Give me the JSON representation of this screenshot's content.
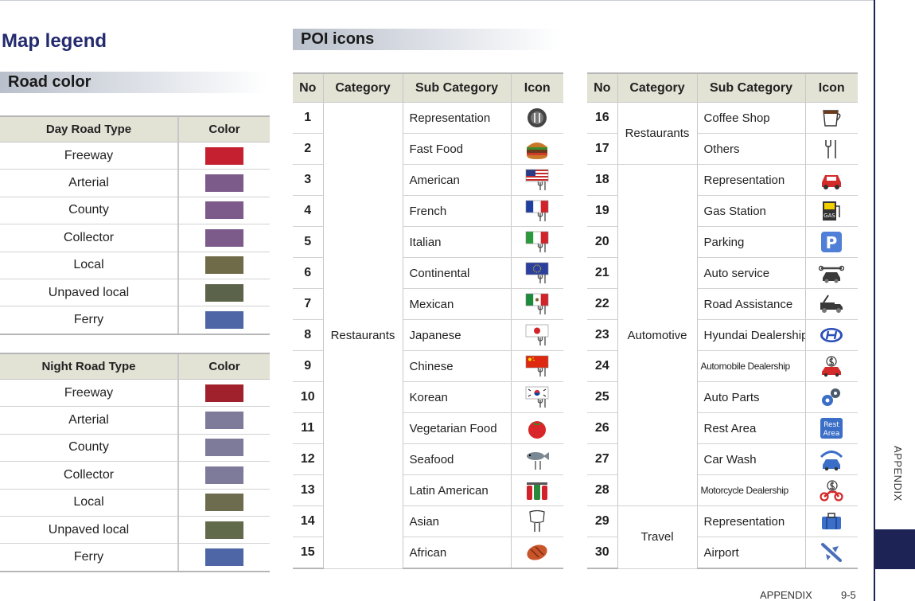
{
  "page_title": "Map legend",
  "sections": {
    "road": "Road color",
    "poi": "POI icons"
  },
  "day_table": {
    "headers": [
      "Day Road Type",
      "Color"
    ],
    "rows": [
      {
        "type": "Freeway",
        "color": "#c5202f"
      },
      {
        "type": "Arterial",
        "color": "#7c5b8a"
      },
      {
        "type": "County",
        "color": "#7c5b8a"
      },
      {
        "type": "Collector",
        "color": "#7c5b8a"
      },
      {
        "type": "Local",
        "color": "#6f6a48"
      },
      {
        "type": "Unpaved local",
        "color": "#5b644a"
      },
      {
        "type": "Ferry",
        "color": "#4f66a6"
      }
    ]
  },
  "night_table": {
    "headers": [
      "Night Road Type",
      "Color"
    ],
    "rows": [
      {
        "type": "Freeway",
        "color": "#a0212c"
      },
      {
        "type": "Arterial",
        "color": "#7d7b99"
      },
      {
        "type": "County",
        "color": "#7d7b99"
      },
      {
        "type": "Collector",
        "color": "#7d7b99"
      },
      {
        "type": "Local",
        "color": "#6e6c4e"
      },
      {
        "type": "Unpaved local",
        "color": "#616b4c"
      },
      {
        "type": "Ferry",
        "color": "#4f66a6"
      }
    ]
  },
  "poi_headers": [
    "No",
    "Category",
    "Sub Category",
    "Icon"
  ],
  "poi_left": {
    "categories": [
      {
        "label": "Restaurants",
        "span": 15
      }
    ],
    "rows": [
      {
        "no": "1",
        "sub": "Representation",
        "icon": "restaurant-plate-icon"
      },
      {
        "no": "2",
        "sub": "Fast Food",
        "icon": "burger-icon"
      },
      {
        "no": "3",
        "sub": "American",
        "icon": "us-flag-fork-icon"
      },
      {
        "no": "4",
        "sub": "French",
        "icon": "french-flag-fork-icon"
      },
      {
        "no": "5",
        "sub": "Italian",
        "icon": "italian-flag-fork-icon"
      },
      {
        "no": "6",
        "sub": "Continental",
        "icon": "eu-flag-fork-icon"
      },
      {
        "no": "7",
        "sub": "Mexican",
        "icon": "mexican-flag-fork-icon"
      },
      {
        "no": "8",
        "sub": "Japanese",
        "icon": "japanese-flag-fork-icon"
      },
      {
        "no": "9",
        "sub": "Chinese",
        "icon": "chinese-flag-fork-icon"
      },
      {
        "no": "10",
        "sub": "Korean",
        "icon": "korean-flag-fork-icon"
      },
      {
        "no": "11",
        "sub": "Vegetarian Food",
        "icon": "tomato-icon"
      },
      {
        "no": "12",
        "sub": "Seafood",
        "icon": "fish-icon"
      },
      {
        "no": "13",
        "sub": "Latin American",
        "icon": "latin-food-icon"
      },
      {
        "no": "14",
        "sub": "Asian",
        "icon": "chopsticks-bowl-icon"
      },
      {
        "no": "15",
        "sub": "African",
        "icon": "grilled-meat-icon"
      }
    ]
  },
  "poi_right": {
    "categories": [
      {
        "label": "Restaurants",
        "span": 2
      },
      {
        "label": "Automotive",
        "span": 11
      },
      {
        "label": "Travel",
        "span": 2
      }
    ],
    "rows": [
      {
        "no": "16",
        "sub": "Coffee Shop",
        "icon": "coffee-cup-icon"
      },
      {
        "no": "17",
        "sub": "Others",
        "icon": "fork-knife-icon"
      },
      {
        "no": "18",
        "sub": "Representation",
        "icon": "car-icon"
      },
      {
        "no": "19",
        "sub": "Gas Station",
        "icon": "gas-pump-icon"
      },
      {
        "no": "20",
        "sub": "Parking",
        "icon": "parking-icon"
      },
      {
        "no": "21",
        "sub": "Auto service",
        "icon": "car-wrench-icon"
      },
      {
        "no": "22",
        "sub": "Road Assistance",
        "icon": "tow-truck-icon"
      },
      {
        "no": "23",
        "sub": "Hyundai Dealership",
        "icon": "hyundai-logo-icon"
      },
      {
        "no": "24",
        "sub": "Automobile Dealership",
        "icon": "car-dollar-icon",
        "small": true
      },
      {
        "no": "25",
        "sub": "Auto Parts",
        "icon": "gears-icon"
      },
      {
        "no": "26",
        "sub": "Rest Area",
        "icon": "rest-area-icon"
      },
      {
        "no": "27",
        "sub": "Car Wash",
        "icon": "car-wash-icon"
      },
      {
        "no": "28",
        "sub": "Motorcycle Dealership",
        "icon": "motorcycle-dollar-icon",
        "small": true
      },
      {
        "no": "29",
        "sub": "Representation",
        "icon": "suitcase-icon"
      },
      {
        "no": "30",
        "sub": "Airport",
        "icon": "airplane-icon"
      }
    ]
  },
  "side_tab": "APPENDIX",
  "footer": {
    "section": "APPENDIX",
    "page": "9-5"
  },
  "rest_area_text": [
    "Rest",
    "Area"
  ],
  "gas_text": "GAS",
  "parking_text": "P"
}
